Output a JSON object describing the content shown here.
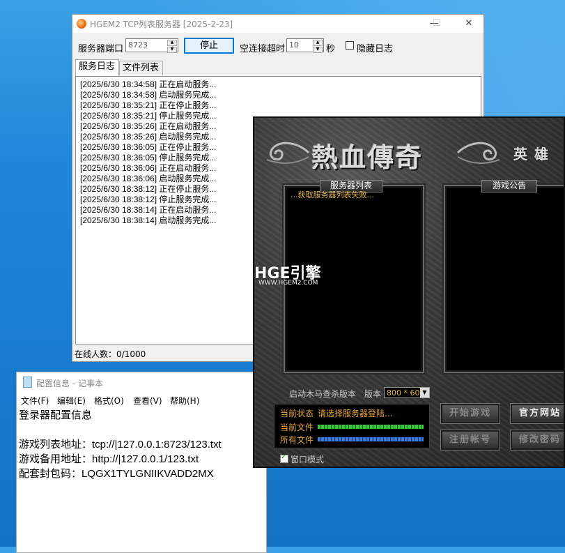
{
  "server_window": {
    "title": "HGEM2 TCP列表服务器 [2025-2-23]",
    "port_label": "服务器端口",
    "port_value": "8723",
    "stop_button": "停止",
    "timeout_label": "空连接超时",
    "timeout_value": "10",
    "timeout_unit": "秒",
    "hide_log_label": "隐藏日志",
    "tabs": [
      "服务日志",
      "文件列表"
    ],
    "log": [
      "[2025/6/30 18:34:58] 正在启动服务...",
      "[2025/6/30 18:34:58] 启动服务完成...",
      "[2025/6/30 18:35:21] 正在停止服务...",
      "[2025/6/30 18:35:21] 停止服务完成...",
      "[2025/6/30 18:35:26] 正在启动服务...",
      "[2025/6/30 18:35:26] 启动服务完成...",
      "[2025/6/30 18:36:05] 正在停止服务...",
      "[2025/6/30 18:36:05] 停止服务完成...",
      "[2025/6/30 18:36:06] 正在启动服务...",
      "[2025/6/30 18:36:06] 启动服务完成...",
      "[2025/6/30 18:38:12] 正在停止服务...",
      "[2025/6/30 18:38:12] 停止服务完成...",
      "[2025/6/30 18:38:14] 正在启动服务...",
      "[2025/6/30 18:38:14] 启动服务完成..."
    ],
    "status": "在线人数：0/1000"
  },
  "notepad": {
    "title": "配置信息 - 记事本",
    "menu": [
      "文件(F)",
      "编辑(E)",
      "格式(O)",
      "查看(V)",
      "帮助(H)"
    ],
    "lines": [
      "登录器配置信息",
      "",
      "游戏列表地址：tcp://|127.0.0.1:8723/123.txt",
      "游戏备用地址：http://|127.0.0.1/123.txt",
      "配套封包码：LQGX1TYLGNIIKVADD2MX"
    ]
  },
  "launcher": {
    "logo": "熱血傳奇",
    "logo_sub": "英雄",
    "watermark": "HGE引擎",
    "watermark_url": "WWW.HGEM2.COM",
    "server_list_title": "服务器列表",
    "server_list_error": "...获取服务器列表失败...",
    "notice_title": "游戏公告",
    "antivirus_label": "启动木马查杀版本",
    "version_label": "版本",
    "version_value": "800 * 60",
    "status_label": "当前状态",
    "status_value": "请选择服务器登陆...",
    "current_file_label": "当前文件",
    "all_files_label": "所有文件",
    "current_file_progress": 1.0,
    "all_files_progress": 1.0,
    "buttons": {
      "start_game": "开始游戏",
      "official_site": "官方网站",
      "register": "注册帐号",
      "change_password": "修改密码"
    },
    "window_mode_label": "窗口模式",
    "window_mode_checked": true
  }
}
